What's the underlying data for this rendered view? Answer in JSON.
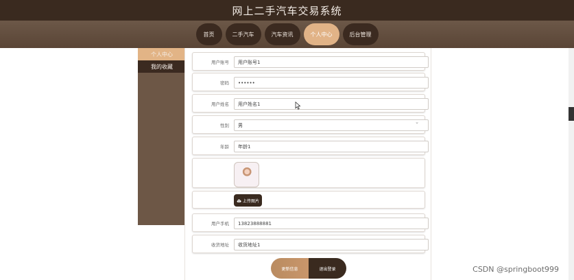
{
  "header": {
    "title": "网上二手汽车交易系统"
  },
  "nav": {
    "items": [
      {
        "label": "首页"
      },
      {
        "label": "二手汽车"
      },
      {
        "label": "汽车资讯"
      },
      {
        "label": "个人中心",
        "active": true
      },
      {
        "label": "后台管理"
      }
    ]
  },
  "sidebar": {
    "items": [
      {
        "label": "个人中心",
        "active": true
      },
      {
        "label": "我的收藏"
      }
    ]
  },
  "form": {
    "account": {
      "label": "用户账号",
      "value": "用户账号1"
    },
    "password": {
      "label": "密码",
      "value": "••••••"
    },
    "name": {
      "label": "用户姓名",
      "value": "用户姓名1"
    },
    "gender": {
      "label": "性别",
      "value": "男"
    },
    "age": {
      "label": "年龄",
      "value": "年龄1"
    },
    "upload": {
      "label": "上传图片"
    },
    "phone": {
      "label": "用户手机",
      "value": "13823888881"
    },
    "address": {
      "label": "收货地址",
      "value": "收货地址1"
    }
  },
  "actions": {
    "update": "更新信息",
    "logout": "退出登录"
  },
  "watermark": "CSDN @springboot999",
  "colors": {
    "brand_dark": "#3a2a1f",
    "brand_mid": "#6d5746",
    "accent": "#e1b387"
  }
}
